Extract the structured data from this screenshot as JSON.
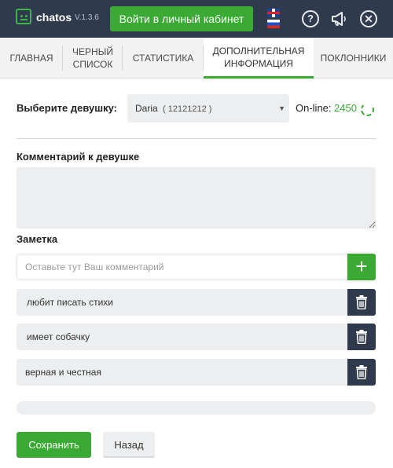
{
  "header": {
    "brand": "chatos",
    "version": "V.1.3.6",
    "login_button": "Войти в личный кабинет",
    "icons": [
      "help-icon",
      "megaphone-icon",
      "close-icon"
    ],
    "help_glyph": "?",
    "close_glyph": "✕",
    "accent_color": "#3aaa35",
    "bar_color": "#2f3b4c"
  },
  "tabs": [
    {
      "label": "ГЛАВНАЯ",
      "active": false
    },
    {
      "label": "ЧЕРНЫЙ СПИСОК",
      "active": false
    },
    {
      "label": "СТАТИСТИКА",
      "active": false
    },
    {
      "label": "ДОПОЛНИТЕЛЬНАЯ ИНФОРМАЦИЯ",
      "active": true
    },
    {
      "label": "ПОКЛОННИКИ",
      "active": false
    }
  ],
  "girl_select": {
    "label": "Выберите девушку:",
    "selected_name": "Daria",
    "selected_id": "( 12121212 )"
  },
  "online": {
    "label": "On-line:",
    "count": "2450"
  },
  "comment": {
    "label": "Комментарий к девушке",
    "value": ""
  },
  "note": {
    "label": "Заметка",
    "placeholder": "Оставьте тут Ваш комментарий",
    "add_glyph": "+",
    "items": [
      "любит писать стихи",
      "имеет собачку",
      "верная и честная"
    ]
  },
  "actions": {
    "save": "Сохранить",
    "back": "Назад"
  }
}
